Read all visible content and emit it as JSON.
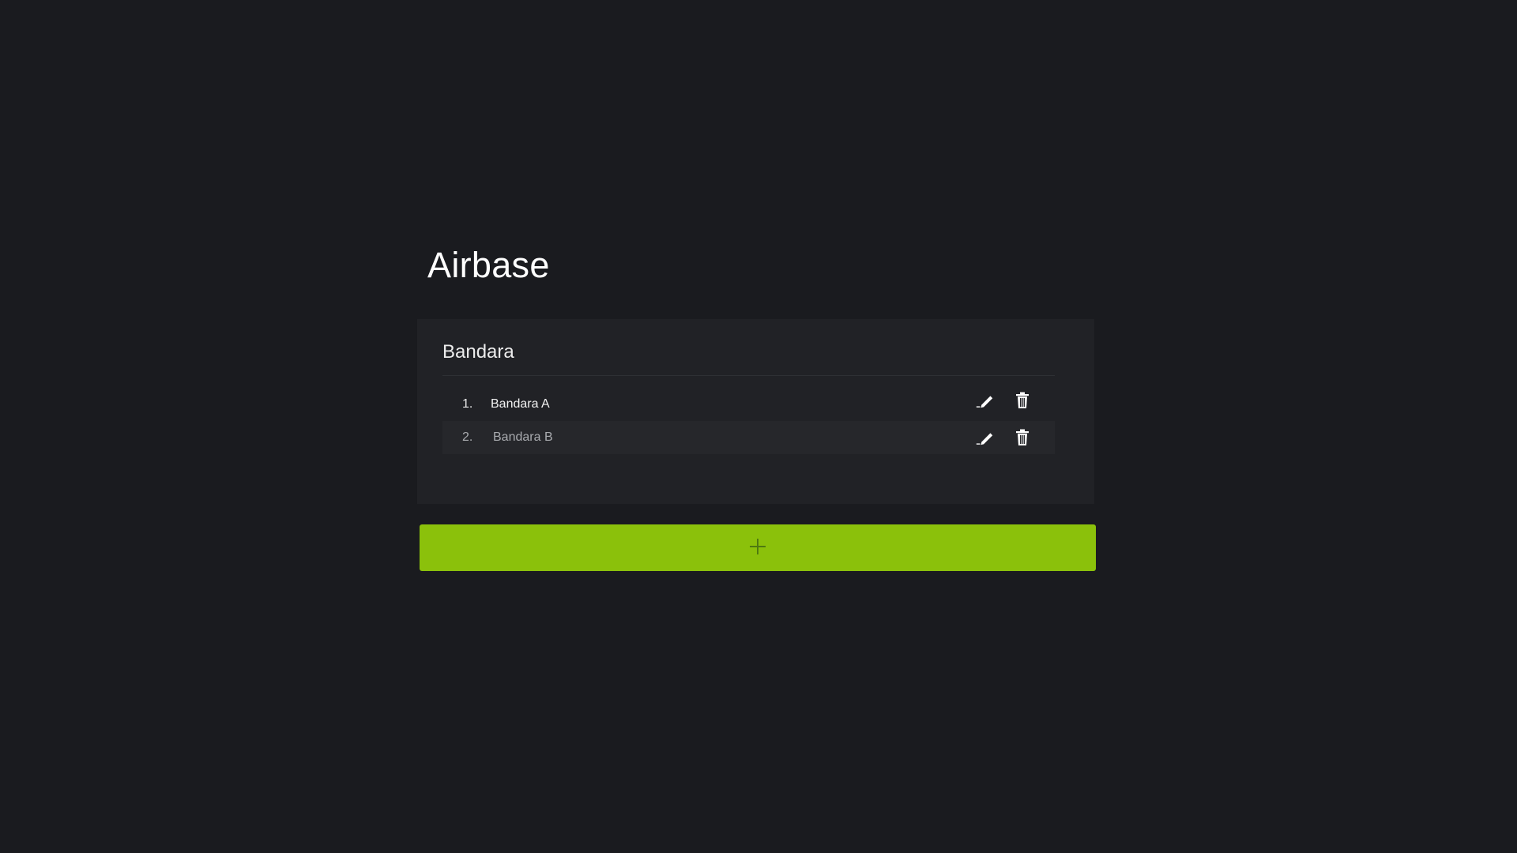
{
  "page": {
    "title": "Airbase"
  },
  "card": {
    "title": "Bandara",
    "items": [
      {
        "number": "1.",
        "label": "Bandara A",
        "edit_icon": "pencil-icon",
        "delete_icon": "trash-icon"
      },
      {
        "number": "2.",
        "label": "Bandara B",
        "edit_icon": "pencil-icon",
        "delete_icon": "trash-icon"
      }
    ]
  },
  "add_button": {
    "icon": "plus-icon"
  },
  "colors": {
    "background": "#1a1b1f",
    "card": "#212226",
    "accent": "#8bc10b",
    "plus_icon": "#4e7a10"
  }
}
